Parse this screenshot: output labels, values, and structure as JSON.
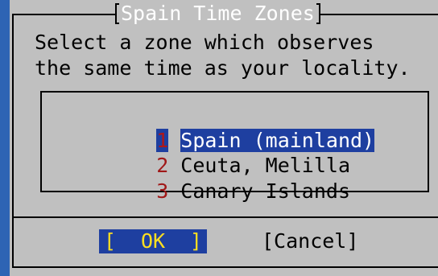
{
  "dialog": {
    "title": "Spain Time Zones",
    "prompt_line1": "Select a zone which observes",
    "prompt_line2": "the same time as your locality."
  },
  "list": {
    "items": [
      {
        "number": "1",
        "label": "Spain (mainland)",
        "selected": true
      },
      {
        "number": "2",
        "label": "Ceuta, Melilla",
        "selected": false
      },
      {
        "number": "3",
        "label": "Canary Islands",
        "selected": false
      }
    ]
  },
  "buttons": {
    "ok_open": "[",
    "ok_label": "OK",
    "ok_close": "]",
    "cancel_label": "[Cancel]"
  },
  "colors": {
    "background": "#2e64b4",
    "dialog": "#c0c0c0",
    "highlight": "#1e3fa0",
    "hotkey": "#a01818",
    "ok_text": "#ffdf20"
  }
}
